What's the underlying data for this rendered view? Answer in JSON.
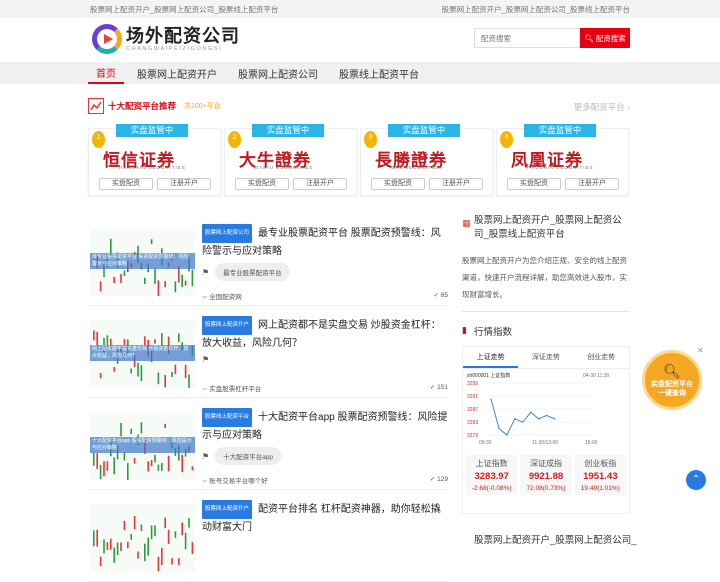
{
  "topbar": {
    "left": "股票网上配资开户_股票网上配资公司_股票线上配资平台",
    "right": "股票网上配资开户_股票网上配资公司_股票线上配资平台"
  },
  "logo": {
    "cn": "场外配资公司",
    "en": "CHANGWAIPEIZIGONGSI"
  },
  "search": {
    "placeholder": "配资搜索",
    "button": "配资搜索"
  },
  "nav": [
    "首页",
    "股票网上配资开户",
    "股票网上配资公司",
    "股票线上配资平台"
  ],
  "recommend": {
    "title": "十大配资平台推荐",
    "count": "共100+平台",
    "more": "更多配资平台",
    "brokers": [
      {
        "rank": "1",
        "tag": "实盘监管中",
        "name": "恒信证券",
        "en": "HENGXIN SECURITIES",
        "btn1": "实盘配资",
        "btn2": "注册开户"
      },
      {
        "rank": "2",
        "tag": "实盘监管中",
        "name": "大牛證券",
        "en": "DANIU SECURITIES",
        "btn1": "实盘配资",
        "btn2": "注册开户"
      },
      {
        "rank": "3",
        "tag": "实盘监管中",
        "name": "長勝證券",
        "en": "WIN SECURITIES",
        "btn1": "实盘配资",
        "btn2": "注册开户"
      },
      {
        "rank": "4",
        "tag": "实盘监管中",
        "name": "凤凰证券",
        "en": "PHOENIX SECURITIES",
        "btn1": "实盘配资",
        "btn2": "注册开户"
      }
    ]
  },
  "articles": [
    {
      "category": "股票网上配资公司",
      "title": "最专业股票配资平台 股票配资预警线：风险警示与应对策略",
      "tag": "最专业股票配资平台",
      "author": "全国配资网",
      "views": "85",
      "thumb_caption": "最专业股票配资平台 股票配资预警线：风险警示与应对策略"
    },
    {
      "category": "股票网上配资开户",
      "title": "网上配资都不是实盘交易 炒股资金杠杆：放大收益，风险几何？",
      "tag": "",
      "author": "实盘股票杠杆平台",
      "views": "151",
      "thumb_caption": "网上配资都不是实盘交易 炒股资金杠杆：放大收益，风险几何？"
    },
    {
      "category": "股票线上配资平台",
      "title": "十大配资平台app 股票配资预警线：风险提示与应对策略",
      "tag": "十大配资平台app",
      "author": "账号交易平台哪个好",
      "views": "129",
      "thumb_caption": "十大配资平台app 股票配资预警线：风险提示与应对策略"
    },
    {
      "category": "股票网上配资开户",
      "title": "配资平台排名 杠杆配资神器，助你轻松撬动财富大门",
      "tag": "",
      "author": "",
      "views": "",
      "thumb_caption": ""
    }
  ],
  "sidebar": {
    "title": "股票网上配资开户_股票网上配资公司_股票线上配资平台",
    "text": "股票网上配资开户为您介绍正规、安全的线上配资渠道，快速开户流程详解，助您高效进入股市，实现财富增长。",
    "next_title": "股票网上配资开户_股票网上配资公司_"
  },
  "quotes": {
    "title": "行情指数",
    "tabs": [
      "上证走势",
      "深证走势",
      "创业走势"
    ],
    "chart_header": "sh000001  上证指数",
    "chart_time": "04-30 11:30",
    "y_ticks": [
      "3295",
      "3291",
      "3287",
      "3283",
      "3279"
    ],
    "x_ticks": [
      "09:30",
      "11:30/13:00",
      "15:00"
    ],
    "cards": [
      {
        "name": "上证指数",
        "value": "3283.97",
        "change": "-2.68(-0.08%)"
      },
      {
        "name": "深证成指",
        "value": "9921.88",
        "change": "72.08(0.73%)"
      },
      {
        "name": "创业板指",
        "value": "1951.43",
        "change": "19.49(1.01%)"
      }
    ]
  },
  "float_badge": {
    "line1": "实盘配资平台",
    "line2": "一键查询"
  },
  "chart_data": {
    "type": "line",
    "title": "上证指数",
    "x": [
      "09:30",
      "10:00",
      "10:30",
      "11:00",
      "11:30",
      "13:30",
      "14:00",
      "14:30",
      "15:00"
    ],
    "series": [
      {
        "name": "上证指数",
        "values": [
          3290,
          3281,
          3279,
          3284,
          3283,
          3286,
          3284,
          3285,
          3284
        ]
      }
    ],
    "ylim": [
      3279,
      3295
    ]
  }
}
